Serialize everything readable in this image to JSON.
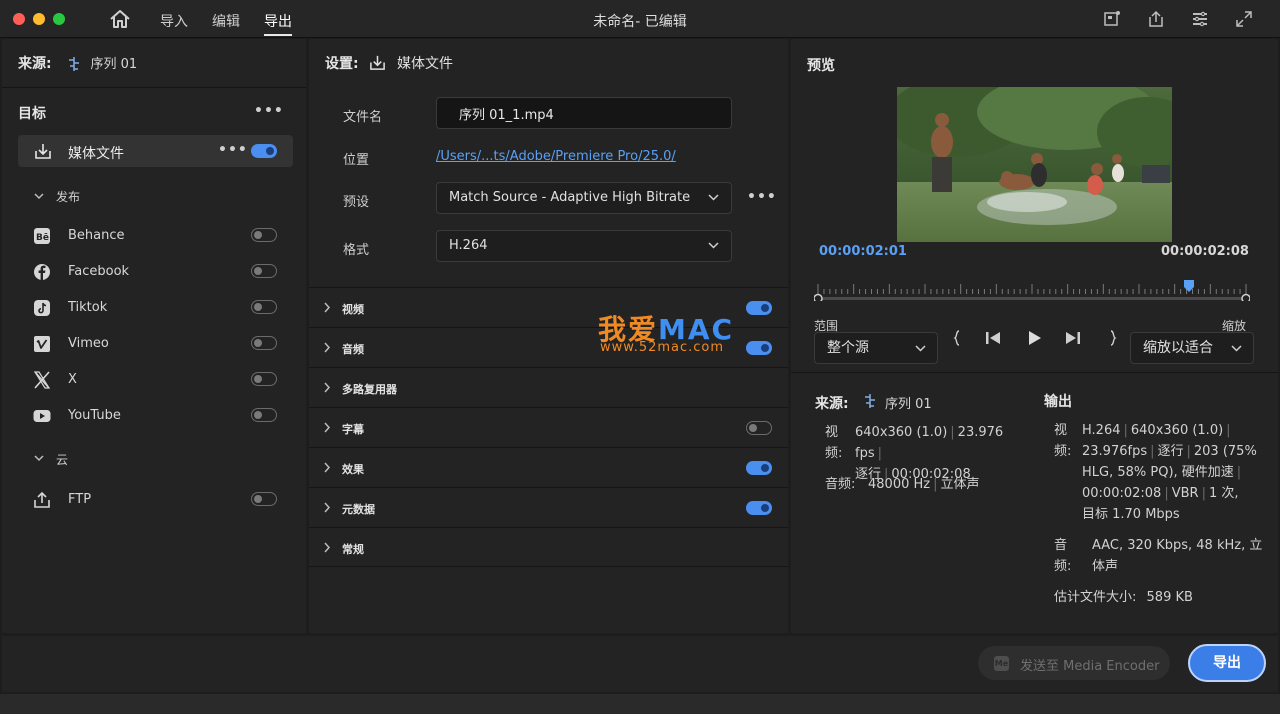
{
  "titlebar": {
    "nav_import": "导入",
    "nav_edit": "编辑",
    "nav_export": "导出",
    "title": "未命名- 已编辑",
    "icons": [
      "home-icon",
      "quick-export-icon",
      "share-icon",
      "workspace-icon",
      "fullscreen-icon"
    ]
  },
  "left": {
    "source_label": "来源:",
    "source_value": "序列 01",
    "target_label": "目标",
    "media_file": "媒体文件",
    "publish_label": "发布",
    "publish_items": [
      {
        "label": "Behance",
        "icon": "behance-icon",
        "enabled": false
      },
      {
        "label": "Facebook",
        "icon": "facebook-icon",
        "enabled": false
      },
      {
        "label": "Tiktok",
        "icon": "tiktok-icon",
        "enabled": false
      },
      {
        "label": "Vimeo",
        "icon": "vimeo-icon",
        "enabled": false
      },
      {
        "label": "X",
        "icon": "x-icon",
        "enabled": false
      },
      {
        "label": "YouTube",
        "icon": "youtube-icon",
        "enabled": false
      }
    ],
    "cloud_label": "云",
    "cloud_items": [
      {
        "label": "FTP",
        "icon": "upload-icon",
        "enabled": false
      }
    ]
  },
  "middle": {
    "settings_label": "设置:",
    "settings_value": "媒体文件",
    "filename_label": "文件名",
    "filename_value": "序列 01_1.mp4",
    "location_label": "位置",
    "location_value": "/Users/...ts/Adobe/Premiere Pro/25.0/",
    "preset_label": "预设",
    "preset_value": "Match Source - Adaptive High Bitrate",
    "format_label": "格式",
    "format_value": "H.264",
    "sections": [
      {
        "label": "视频",
        "toggle": "on"
      },
      {
        "label": "音频",
        "toggle": "on"
      },
      {
        "label": "多路复用器",
        "toggle": "none"
      },
      {
        "label": "字幕",
        "toggle": "off"
      },
      {
        "label": "效果",
        "toggle": "on"
      },
      {
        "label": "元数据",
        "toggle": "on"
      },
      {
        "label": "常规",
        "toggle": "none"
      }
    ],
    "watermark_big_cn": "我爱",
    "watermark_big_en": "MAC",
    "watermark_small": "www.52mac.com"
  },
  "right": {
    "preview_label": "预览",
    "timecode_in": "00:00:02:01",
    "timecode_out": "00:00:02:08",
    "range_label": "范围",
    "range_value": "整个源",
    "zoom_label": "缩放",
    "zoom_value": "缩放以适合",
    "source_label": "来源:",
    "source_value": "序列 01",
    "output_label": "输出",
    "src_video_key": "视频:",
    "src_video_value": [
      "640x360 (1.0)",
      "23.976 fps",
      "逐行",
      "00:00:02:08"
    ],
    "src_audio_key": "音频:",
    "src_audio_value": [
      "48000 Hz",
      "立体声"
    ],
    "out_video_key": "视频:",
    "out_video_lines": [
      "H.264",
      "640x360 (1.0)",
      "23.976fps",
      "逐行",
      "203 (75%",
      "HLG, 58% PQ), 硬件加速",
      "00:00:02:08",
      "VBR",
      "1 次,",
      "目标 1.70 Mbps"
    ],
    "out_audio_key": "音频:",
    "out_audio_lines": [
      "AAC, 320 Kbps, 48 kHz, 立",
      "体声"
    ],
    "est_size_label": "估计文件大小:",
    "est_size_value": "589 KB"
  },
  "bottom": {
    "send_me_badge": "Me",
    "send_label": "发送至 Media Encoder",
    "export_label": "导出"
  },
  "colors": {
    "accent": "#3c7ee8",
    "link": "#5aa0f5",
    "timecode": "#5aa0f5"
  }
}
